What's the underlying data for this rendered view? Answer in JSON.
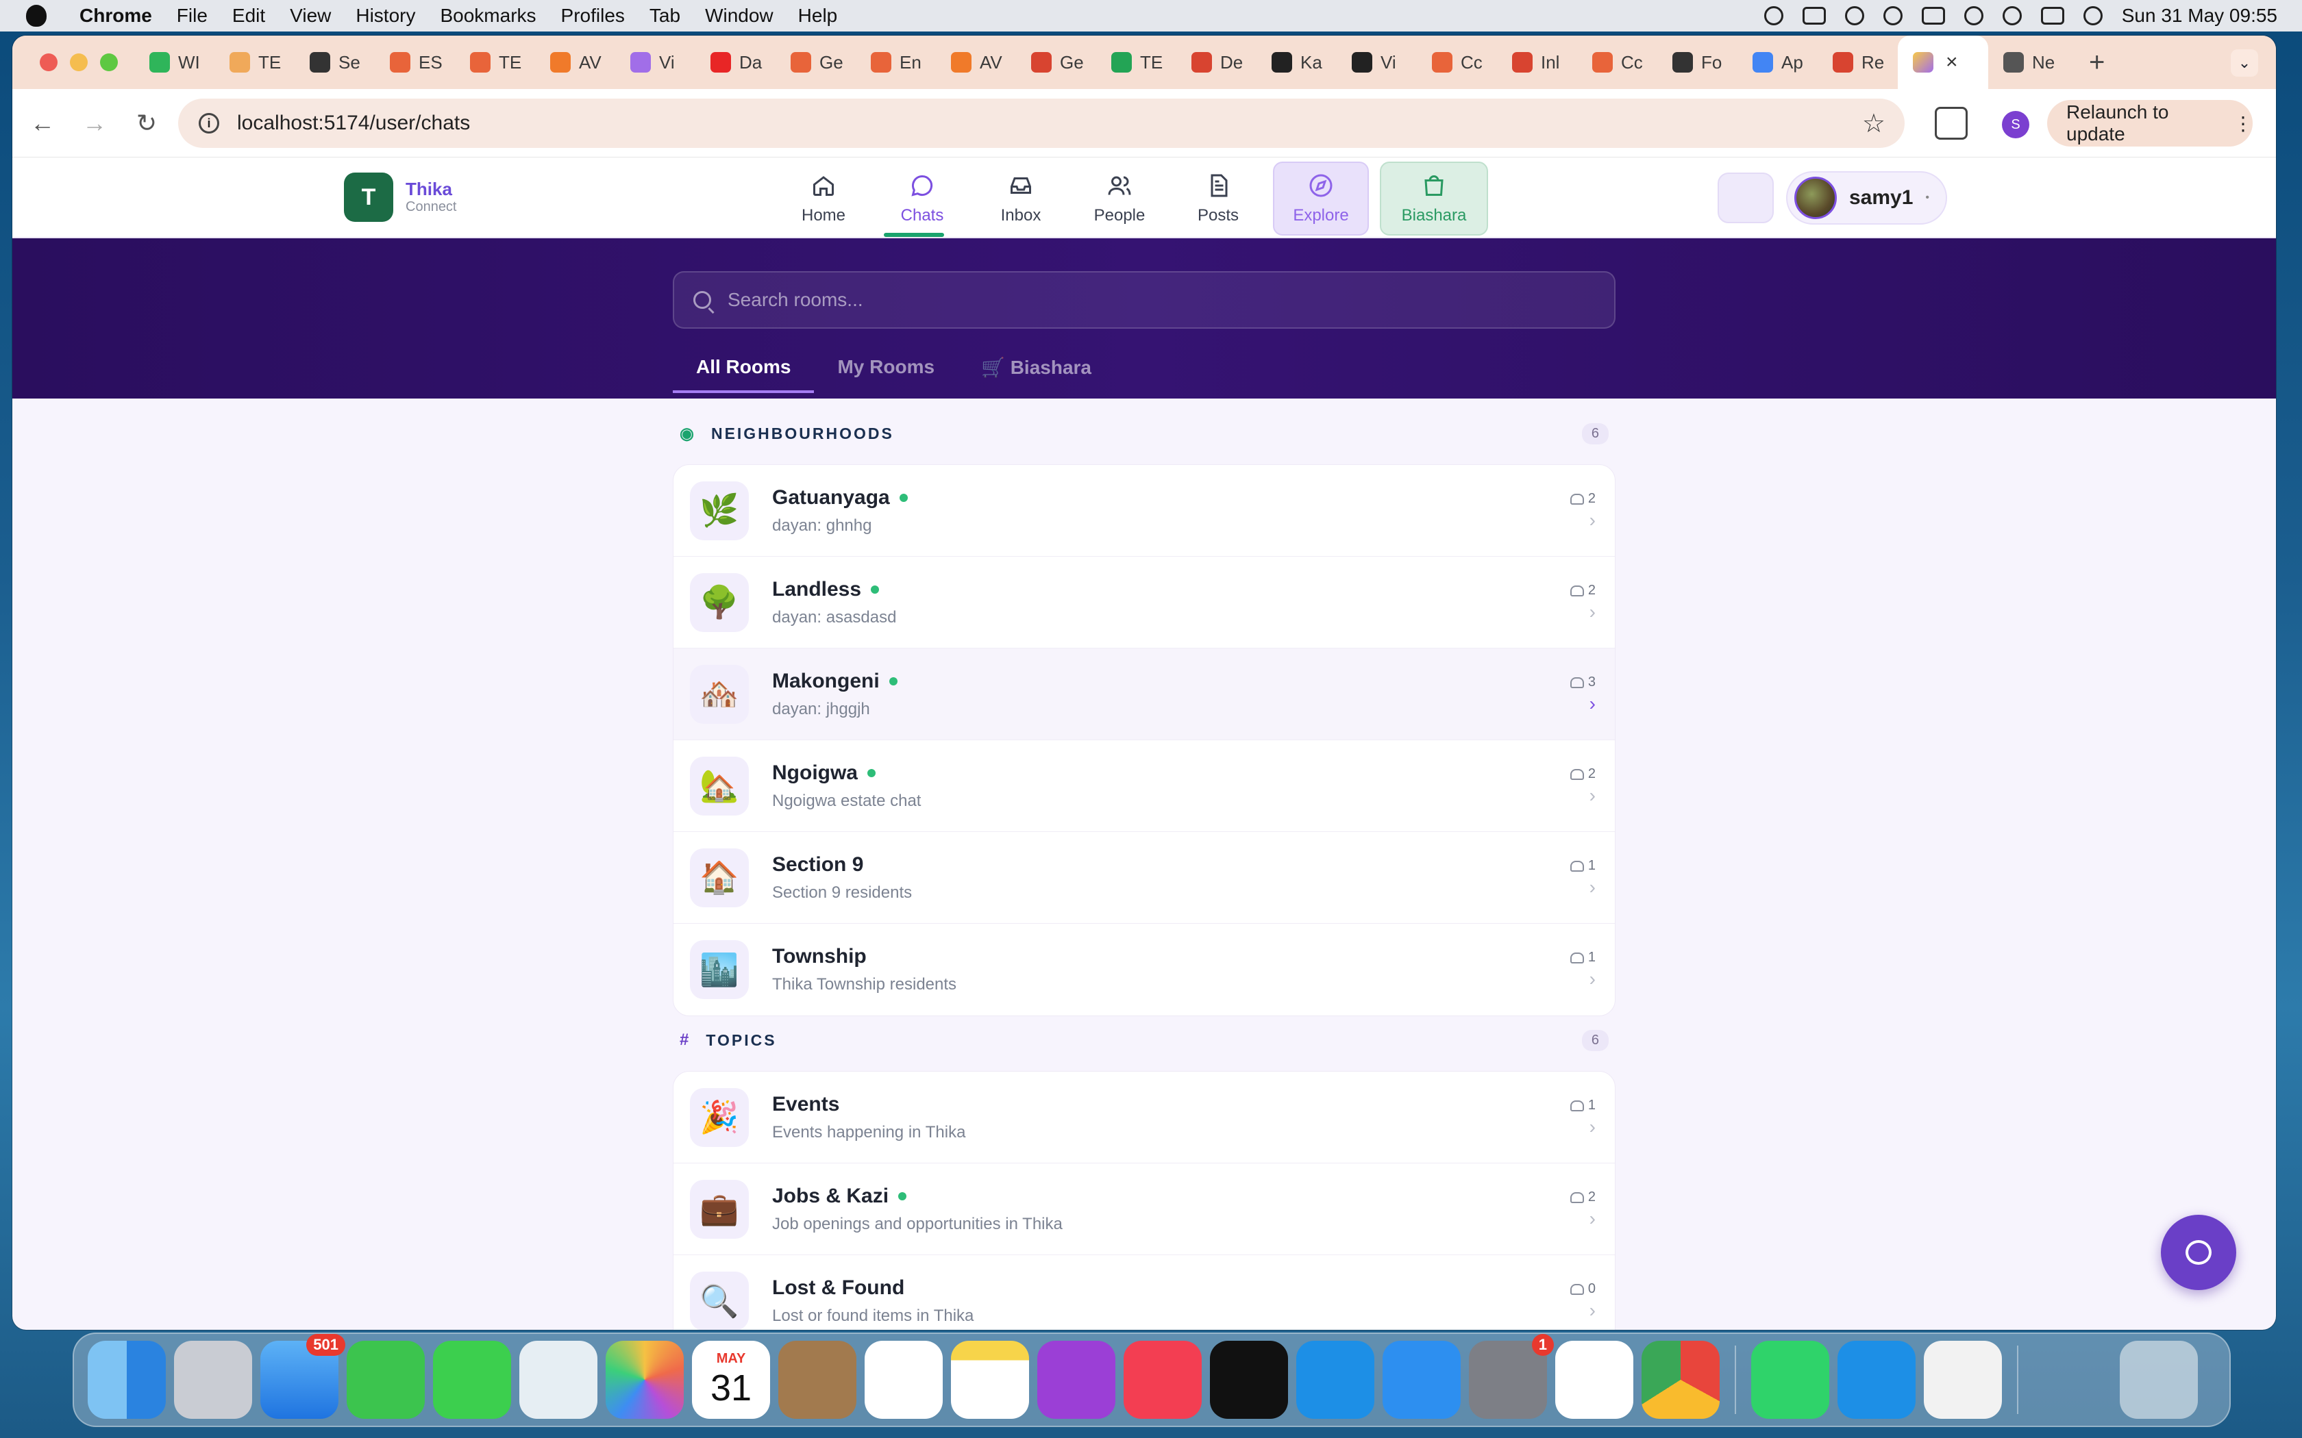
{
  "menubar": {
    "app": "Chrome",
    "items": [
      "File",
      "Edit",
      "View",
      "History",
      "Bookmarks",
      "Profiles",
      "Tab",
      "Window",
      "Help"
    ],
    "clock": "Sun 31 May  09:55"
  },
  "browser": {
    "tabs": [
      {
        "label": "WI",
        "color": "#2fb55a"
      },
      {
        "label": "TE",
        "color": "#f0a95a"
      },
      {
        "label": "Se",
        "color": "#333333"
      },
      {
        "label": "ES",
        "color": "#e8643a"
      },
      {
        "label": "TE",
        "color": "#e8643a"
      },
      {
        "label": "AV",
        "color": "#f07a2a"
      },
      {
        "label": "Vi",
        "color": "#a16ee8"
      },
      {
        "label": "Da",
        "color": "#e82626"
      },
      {
        "label": "Ge",
        "color": "#e8643a"
      },
      {
        "label": "En",
        "color": "#e8643a"
      },
      {
        "label": "AV",
        "color": "#f07a2a"
      },
      {
        "label": "Ge",
        "color": "#d84430"
      },
      {
        "label": "TE",
        "color": "#23a455"
      },
      {
        "label": "De",
        "color": "#d84430"
      },
      {
        "label": "Ka",
        "color": "#222222"
      },
      {
        "label": "Vi",
        "color": "#222222"
      },
      {
        "label": "Cc",
        "color": "#e8643a"
      },
      {
        "label": "Inl",
        "color": "#d84430"
      },
      {
        "label": "Cc",
        "color": "#e8643a"
      },
      {
        "label": "Fo",
        "color": "#333333"
      },
      {
        "label": "Ap",
        "color": "#4285f4"
      },
      {
        "label": "Re",
        "color": "#d84430"
      }
    ],
    "active_tab_close": "×",
    "after_tab": {
      "label": "Ne",
      "color": "#555555"
    },
    "new_tab": "+",
    "url": "localhost:5174/user/chats",
    "profile_initial": "S",
    "relaunch_label": "Relaunch to update"
  },
  "app": {
    "brand_name": "Thika",
    "brand_sub": "Connect",
    "logo_letter": "T",
    "nav": [
      {
        "label": "Home",
        "icon": "home-icon"
      },
      {
        "label": "Chats",
        "icon": "chat-bubble-icon"
      },
      {
        "label": "Inbox",
        "icon": "inbox-icon"
      },
      {
        "label": "People",
        "icon": "people-icon"
      },
      {
        "label": "Posts",
        "icon": "document-icon"
      },
      {
        "label": "Explore",
        "icon": "compass-icon"
      },
      {
        "label": "Biashara",
        "icon": "shopping-bag-icon"
      }
    ],
    "username": "samy1",
    "search_placeholder": "Search rooms...",
    "tabs": [
      "All Rooms",
      "My Rooms",
      "🛒 Biashara"
    ]
  },
  "sections": [
    {
      "title": "NEIGHBOURHOODS",
      "count": "6",
      "rooms": [
        {
          "emoji": "🌿",
          "name": "Gatuanyaga",
          "online": true,
          "desc": "dayan: ghnhg",
          "members": "2"
        },
        {
          "emoji": "🌳",
          "name": "Landless",
          "online": true,
          "desc": "dayan: asasdasd",
          "members": "2"
        },
        {
          "emoji": "🏘️",
          "name": "Makongeni",
          "online": true,
          "desc": "dayan: jhggjh",
          "members": "3"
        },
        {
          "emoji": "🏡",
          "name": "Ngoigwa",
          "online": true,
          "desc": "Ngoigwa estate chat",
          "members": "2"
        },
        {
          "emoji": "🏠",
          "name": "Section 9",
          "online": false,
          "desc": "Section 9 residents",
          "members": "1"
        },
        {
          "emoji": "🏙️",
          "name": "Township",
          "online": false,
          "desc": "Thika Township residents",
          "members": "1"
        }
      ]
    },
    {
      "title": "TOPICS",
      "count": "6",
      "rooms": [
        {
          "emoji": "🎉",
          "name": "Events",
          "online": false,
          "desc": "Events happening in Thika",
          "members": "1"
        },
        {
          "emoji": "💼",
          "name": "Jobs & Kazi",
          "online": true,
          "desc": "Job openings and opportunities in Thika",
          "members": "2"
        },
        {
          "emoji": "🔍",
          "name": "Lost & Found",
          "online": false,
          "desc": "Lost or found items in Thika",
          "members": "0"
        }
      ]
    }
  ],
  "dock": {
    "mail_badge": "501",
    "settings_badge": "1",
    "calendar_month": "MAY",
    "calendar_day": "31"
  }
}
